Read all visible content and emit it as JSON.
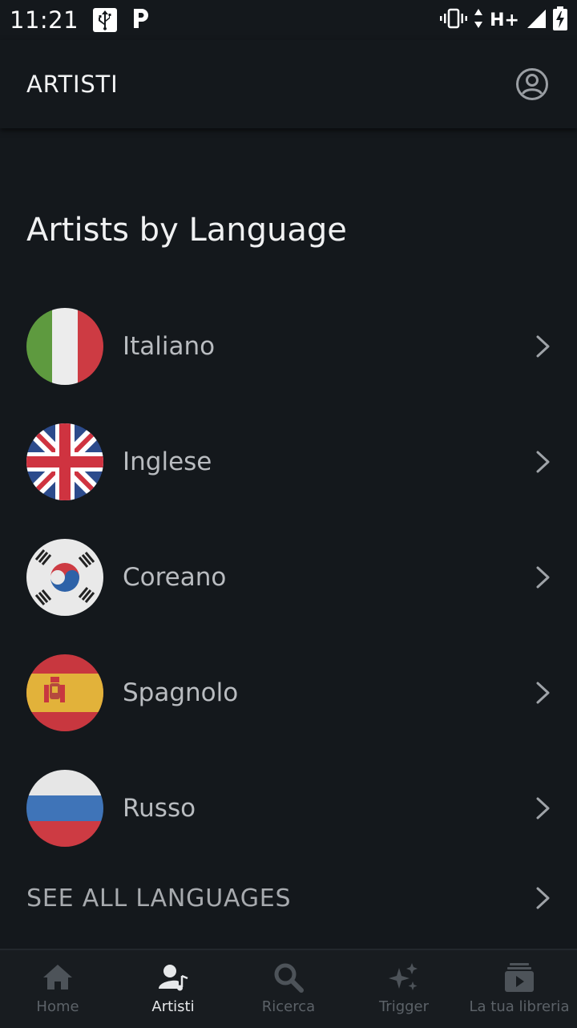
{
  "status_bar": {
    "time": "11:21",
    "network": "H+"
  },
  "app_bar": {
    "title": "ARTISTI"
  },
  "section": {
    "title": "Artists by Language"
  },
  "languages": [
    {
      "label": "Italiano",
      "flag": "italy-flag"
    },
    {
      "label": "Inglese",
      "flag": "uk-flag"
    },
    {
      "label": "Coreano",
      "flag": "south-korea-flag"
    },
    {
      "label": "Spagnolo",
      "flag": "spain-flag"
    },
    {
      "label": "Russo",
      "flag": "russia-flag"
    }
  ],
  "see_all": {
    "label": "SEE ALL LANGUAGES"
  },
  "bottom_nav": [
    {
      "label": "Home",
      "icon": "home-icon",
      "active": false
    },
    {
      "label": "Artisti",
      "icon": "artist-icon",
      "active": true
    },
    {
      "label": "Ricerca",
      "icon": "search-icon",
      "active": false
    },
    {
      "label": "Trigger",
      "icon": "sparkle-icon",
      "active": false
    },
    {
      "label": "La tua libreria",
      "icon": "library-icon",
      "active": false
    }
  ],
  "colors": {
    "background": "#14181c",
    "text_primary": "#f0f1f2",
    "text_secondary": "#b9bcc0",
    "nav_inactive": "#5c6268"
  }
}
